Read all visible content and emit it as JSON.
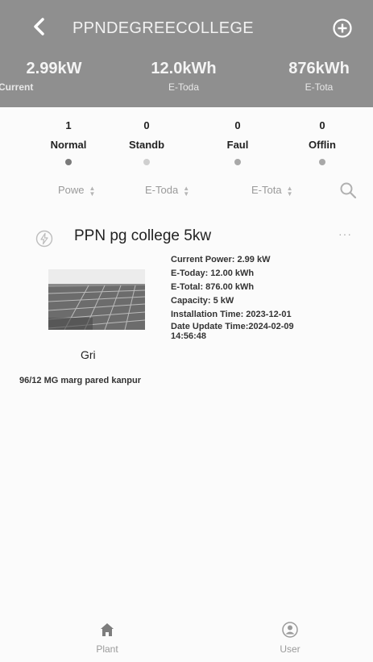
{
  "header": {
    "title": "PPNDEGREECOLLEGE",
    "stats": [
      {
        "value": "2.99kW",
        "label": "Current"
      },
      {
        "value": "12.0kWh",
        "label": "E-Toda"
      },
      {
        "value": "876kWh",
        "label": "E-Tota"
      }
    ]
  },
  "status_filters": [
    {
      "count": "1",
      "label": "Normal",
      "color": "#7a7a7a"
    },
    {
      "count": "0",
      "label": "Standb",
      "color": "#cfcfcf"
    },
    {
      "count": "0",
      "label": "Faul",
      "color": "#a8a8a8"
    },
    {
      "count": "0",
      "label": "Offlin",
      "color": "#a8a8a8"
    }
  ],
  "sort": [
    {
      "label": "Powe"
    },
    {
      "label": "E-Toda"
    },
    {
      "label": "E-Tota"
    }
  ],
  "plant": {
    "name": "PPN pg college 5kw",
    "more": "···",
    "grid_label": "Gri",
    "details": [
      "Current Power: 2.99 kW",
      "E-Today: 12.00 kWh",
      "E-Total: 876.00 kWh",
      "Capacity: 5 kW",
      "Installation Time: 2023-12-01",
      "Date Update Time:2024-02-09",
      "14:56:48"
    ],
    "address": "96/12 MG marg pared kanpur"
  },
  "bottom_nav": [
    {
      "label": "Plant",
      "icon": "home-icon"
    },
    {
      "label": "User",
      "icon": "user-icon"
    }
  ]
}
